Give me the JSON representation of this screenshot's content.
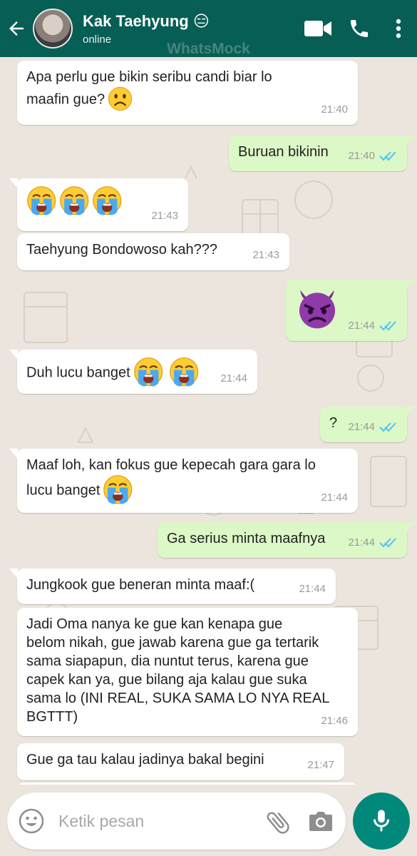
{
  "header": {
    "contact_name": "Kak Taehyung 😑",
    "status": "online",
    "watermark": "WhatsMock"
  },
  "messages": [
    {
      "direction": "in",
      "text": "Apa perlu gue bikin seribu candi biar lo\nmaafin gue?",
      "emoji": [
        "frowning"
      ],
      "time": "21:40"
    },
    {
      "direction": "out",
      "text": "Buruan bikinin",
      "time": "21:40",
      "read": true
    },
    {
      "direction": "in",
      "text": "",
      "emoji": [
        "loudly-crying",
        "loudly-crying",
        "loudly-crying"
      ],
      "time": "21:43"
    },
    {
      "direction": "in",
      "text": "Taehyung Bondowoso kah???",
      "time": "21:43"
    },
    {
      "direction": "out",
      "text": "",
      "emoji": [
        "angry-devil"
      ],
      "time": "21:44",
      "read": true
    },
    {
      "direction": "in",
      "text": "Duh lucu banget",
      "emoji": [
        "loudly-crying",
        "loudly-crying"
      ],
      "time": "21:44"
    },
    {
      "direction": "out",
      "text": "?",
      "time": "21:44",
      "read": true
    },
    {
      "direction": "in",
      "text": "Maaf loh, kan fokus gue kepecah gara gara lo\nlucu banget",
      "emoji": [
        "loudly-crying"
      ],
      "time": "21:44"
    },
    {
      "direction": "out",
      "text": "Ga serius minta maafnya",
      "time": "21:44",
      "read": true
    },
    {
      "direction": "in",
      "text": "Jungkook gue beneran minta maaf:(",
      "time": "21:44"
    },
    {
      "direction": "in",
      "text": "Jadi Oma nanya ke gue kan kenapa gue\nbelom nikah, gue jawab karena gue ga tertarik\nsama siapapun, dia nuntut terus, karena gue\ncapek kan ya, gue bilang aja kalau gue suka\nsama lo (INI REAL, SUKA SAMA LO NYA REAL\nBGTTT)",
      "time": "21:46"
    },
    {
      "direction": "in",
      "text": "Gue ga tau kalau jadinya bakal begini",
      "time": "21:47"
    }
  ],
  "composer": {
    "placeholder": "Ketik pesan"
  },
  "icons": {
    "back": "arrow-left-icon",
    "video": "video-call-icon",
    "phone": "phone-icon",
    "menu": "more-vert-icon",
    "emoji": "smiley-icon",
    "attach": "paperclip-icon",
    "camera": "camera-icon",
    "mic": "mic-icon"
  },
  "colors": {
    "header": "#075e54",
    "chat_background": "#ece5dd",
    "outgoing_bubble": "#dcf8c6",
    "incoming_bubble": "#ffffff",
    "read_ticks": "#4fc3f7",
    "mic_button": "#00897b"
  }
}
